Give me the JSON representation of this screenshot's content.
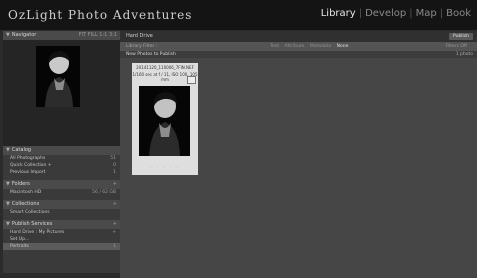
{
  "app": {
    "brand": "OzLight Photo Adventures",
    "modules": [
      "Library",
      "Develop",
      "Map",
      "Book"
    ],
    "active_module": "Library"
  },
  "navigator": {
    "title": "Navigator",
    "zoom": "FIT  FILL  1:1  3:1"
  },
  "catalog": {
    "title": "Catalog",
    "items": [
      {
        "label": "All Photographs",
        "count": "51"
      },
      {
        "label": "Quick Collection +",
        "count": "0"
      },
      {
        "label": "Previous Import",
        "count": "1"
      }
    ]
  },
  "folders": {
    "title": "Folders",
    "items": [
      {
        "label": "Macintosh HD",
        "count": "56 / 62 GB"
      }
    ]
  },
  "collections": {
    "title": "Collections",
    "items": [
      {
        "label": "Smart Collections",
        "count": ""
      }
    ]
  },
  "publish": {
    "title": "Publish Services",
    "items": [
      {
        "label": "Hard Drive : My Pictures",
        "count": "+"
      },
      {
        "label": "Set Up...",
        "count": ""
      },
      {
        "label": "Portraits",
        "count": "1"
      }
    ]
  },
  "toolbar": {
    "service": "Hard Drive",
    "publish_label": "Publish"
  },
  "filterbar": {
    "label": "Library Filter :",
    "options": [
      "Text",
      "Attribute",
      "Metadata",
      "None"
    ],
    "active": "None",
    "right": "Filters Off"
  },
  "section": {
    "title": "New Photos to Publish",
    "right_label": "1 photo"
  },
  "photo": {
    "filename": "20141120_110006_7FIN.NEF",
    "exif": "1/160 sec at f / 11, ISO 100, 105 mm",
    "stars": "· · · · ·"
  }
}
